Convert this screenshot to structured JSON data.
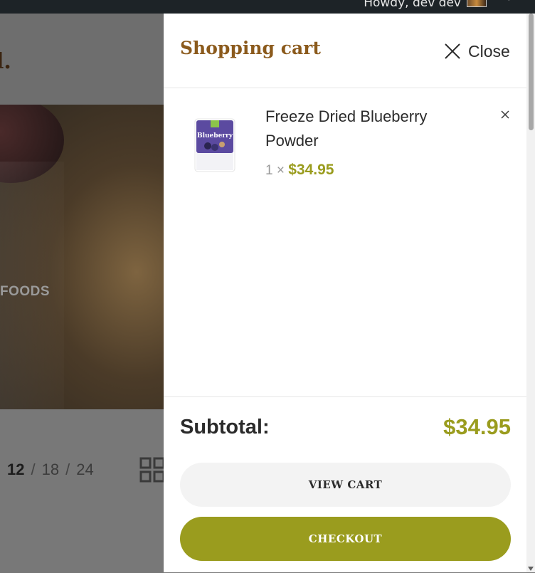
{
  "admin_bar": {
    "greeting": "Howdy, dev dev"
  },
  "background_page": {
    "logo_fragment": "l.",
    "hero_text_fragment": "FOODS",
    "per_page": {
      "current": "12",
      "separator": "/",
      "option_2": "18",
      "option_3": "24"
    },
    "icons": [
      "grid-view-icon"
    ]
  },
  "cart": {
    "title": "Shopping cart",
    "close_label": "Close",
    "items": [
      {
        "name": "Freeze Dried Blueberry Powder",
        "quantity_text": "1 ×",
        "price": "$34.95",
        "thumbnail_label": "Blueberry"
      }
    ],
    "subtotal_label": "Subtotal:",
    "subtotal_value": "$34.95",
    "view_cart_label": "VIEW CART",
    "checkout_label": "CHECKOUT"
  },
  "colors": {
    "accent_olive": "#9a9c1e",
    "title_brown": "#8b5a1c",
    "admin_bar": "#1d2327"
  }
}
